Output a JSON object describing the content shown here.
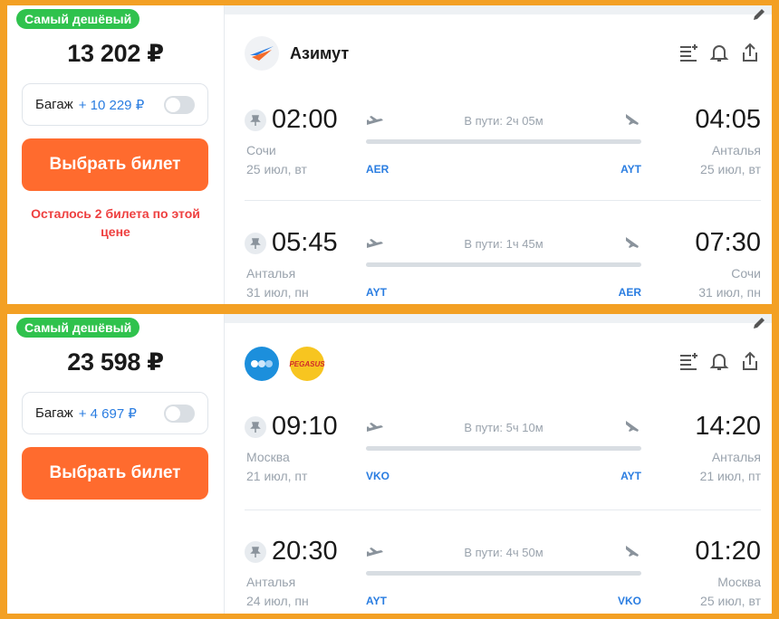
{
  "offers": [
    {
      "badge": "Самый дешёвый",
      "price": "13 202 ₽",
      "baggage_label": "Багаж",
      "baggage_price": "+ 10 229 ₽",
      "button": "Выбрать билет",
      "warning": "Осталось 2 билета по этой цене",
      "airline": "Азимут",
      "segments": [
        {
          "dep_time": "02:00",
          "arr_time": "04:05",
          "duration": "В пути: 2ч 05м",
          "dep_city": "Сочи",
          "arr_city": "Анталья",
          "dep_date": "25 июл, вт",
          "arr_date": "25 июл, вт",
          "dep_code": "AER",
          "arr_code": "AYT"
        },
        {
          "dep_time": "05:45",
          "arr_time": "07:30",
          "duration": "В пути: 1ч 45м",
          "dep_city": "Анталья",
          "arr_city": "Сочи",
          "dep_date": "31 июл, пн",
          "arr_date": "31 июл, пн",
          "dep_code": "AYT",
          "arr_code": "AER"
        }
      ]
    },
    {
      "badge": "Самый дешёвый",
      "price": "23 598 ₽",
      "baggage_label": "Багаж",
      "baggage_price": "+ 4 697 ₽",
      "button": "Выбрать билет",
      "airline_logo_text": "PEGASUS",
      "segments": [
        {
          "dep_time": "09:10",
          "arr_time": "14:20",
          "duration": "В пути: 5ч 10м",
          "dep_city": "Москва",
          "arr_city": "Анталья",
          "dep_date": "21 июл, пт",
          "arr_date": "21 июл, пт",
          "dep_code": "VKO",
          "arr_code": "AYT"
        },
        {
          "dep_time": "20:30",
          "arr_time": "01:20",
          "duration": "В пути: 4ч 50м",
          "dep_city": "Анталья",
          "arr_city": "Москва",
          "dep_date": "24 июл, пн",
          "arr_date": "25 июл, вт",
          "dep_code": "AYT",
          "arr_code": "VKO"
        }
      ]
    }
  ],
  "colors": {
    "accent": "#ff6b2e",
    "badge": "#2fc24d",
    "link": "#2a7de1",
    "warning": "#ee3f3f",
    "frame": "#f3a024"
  }
}
